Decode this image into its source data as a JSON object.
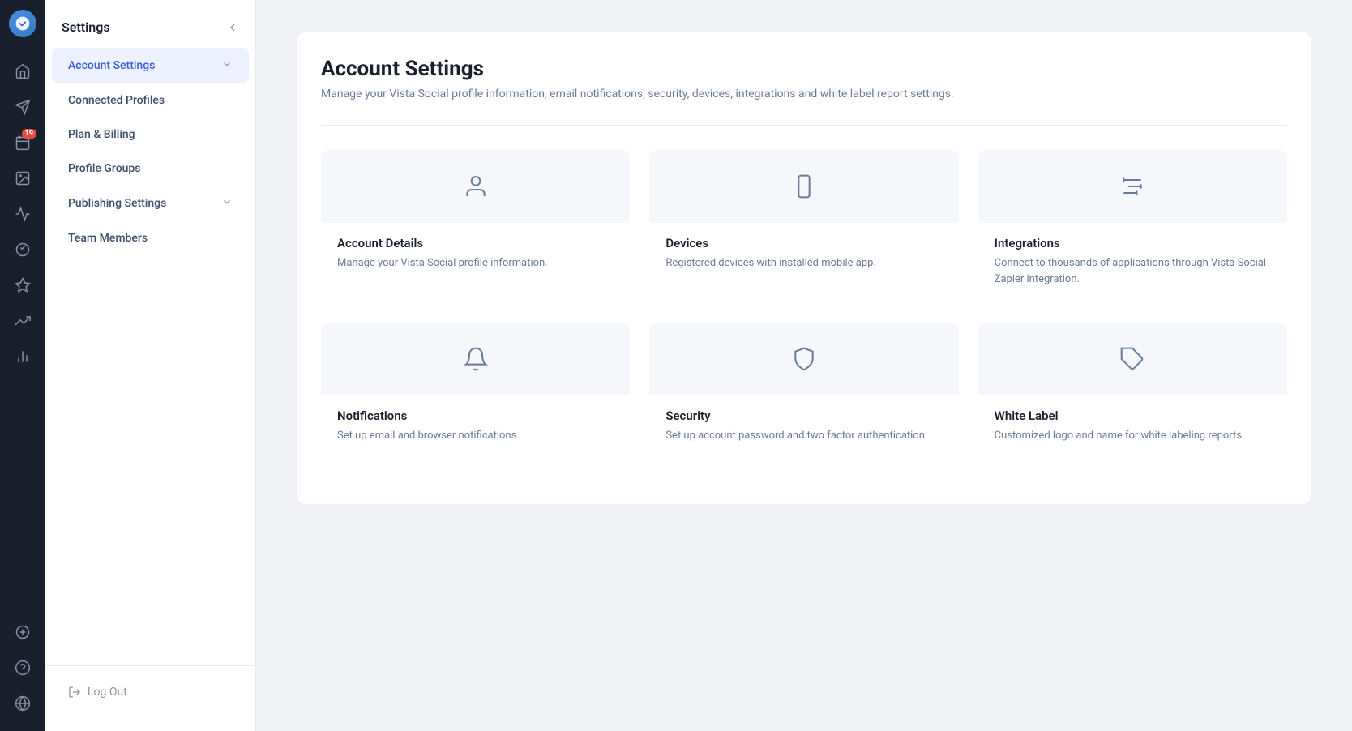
{
  "iconNav": {
    "logoAlt": "Vista Social Logo"
  },
  "sidebar": {
    "title": "Settings",
    "collapseIcon": "chevron-left",
    "items": [
      {
        "id": "account-settings",
        "label": "Account Settings",
        "active": true,
        "hasChevron": true
      },
      {
        "id": "connected-profiles",
        "label": "Connected Profiles",
        "active": false,
        "hasChevron": false
      },
      {
        "id": "plan-billing",
        "label": "Plan & Billing",
        "active": false,
        "hasChevron": false
      },
      {
        "id": "profile-groups",
        "label": "Profile Groups",
        "active": false,
        "hasChevron": false
      },
      {
        "id": "publishing-settings",
        "label": "Publishing Settings",
        "active": false,
        "hasChevron": true
      },
      {
        "id": "team-members",
        "label": "Team Members",
        "active": false,
        "hasChevron": false
      }
    ],
    "logout": "Log Out"
  },
  "main": {
    "title": "Account Settings",
    "subtitle": "Manage your Vista Social profile information, email notifications, security, devices, integrations and white label report settings.",
    "cards": [
      {
        "id": "account-details",
        "title": "Account Details",
        "desc": "Manage your Vista Social profile information.",
        "icon": "user"
      },
      {
        "id": "devices",
        "title": "Devices",
        "desc": "Registered devices with installed mobile app.",
        "icon": "mobile"
      },
      {
        "id": "integrations",
        "title": "Integrations",
        "desc": "Connect to thousands of applications through Vista Social Zapier integration.",
        "icon": "sliders"
      },
      {
        "id": "notifications",
        "title": "Notifications",
        "desc": "Set up email and browser notifications.",
        "icon": "bell"
      },
      {
        "id": "security",
        "title": "Security",
        "desc": "Set up account password and two factor authentication.",
        "icon": "shield"
      },
      {
        "id": "white-label",
        "title": "White Label",
        "desc": "Customized logo and name for white labeling reports.",
        "icon": "tag"
      }
    ]
  },
  "notificationBadge": "19"
}
